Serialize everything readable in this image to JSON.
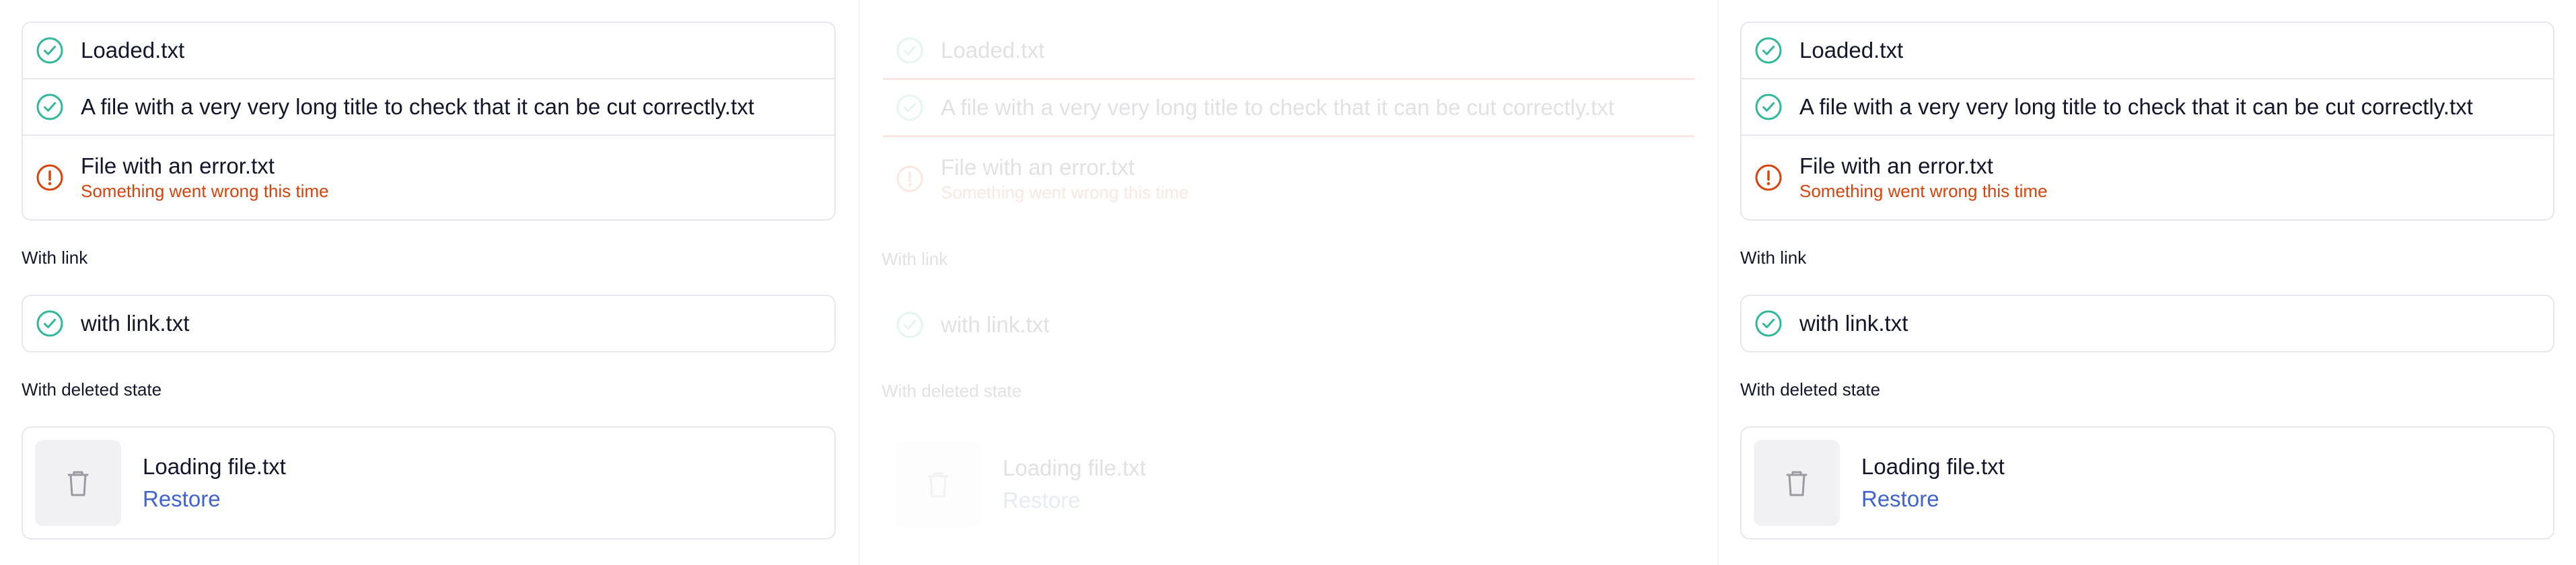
{
  "files": [
    {
      "name": "Loaded.txt",
      "status": "success",
      "icon": "check-circle-icon"
    },
    {
      "name": "A file with a very very long title to check that it can be cut correctly.txt",
      "status": "success",
      "icon": "check-circle-icon"
    },
    {
      "name": "File with an error.txt",
      "status": "error",
      "icon": "error-circle-icon",
      "error": "Something went wrong this time"
    }
  ],
  "with_link": {
    "label": "With link",
    "file": {
      "name": "with link.txt",
      "status": "success",
      "icon": "check-circle-icon"
    }
  },
  "deleted": {
    "label": "With deleted state",
    "file_name": "Loading file.txt",
    "restore_label": "Restore",
    "icon": "trash-icon"
  },
  "colors": {
    "success": "#2fb89a",
    "error": "#d9420b",
    "link": "#3f63d3",
    "border": "#e7e7ec",
    "drop_highlight": "#e53935"
  }
}
